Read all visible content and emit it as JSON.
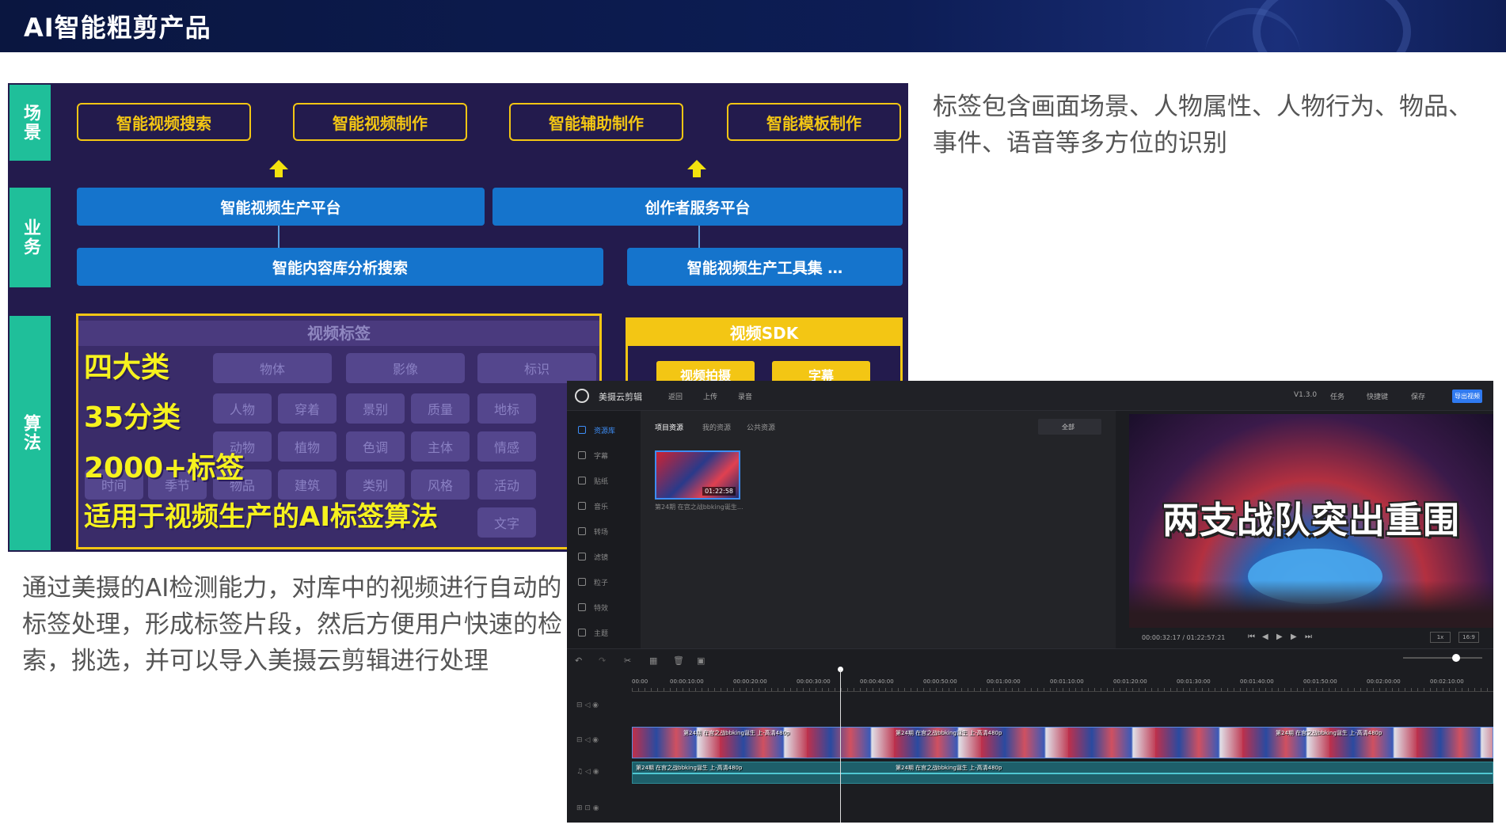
{
  "header": {
    "title": "AI智能粗剪产品"
  },
  "architecture": {
    "side_labels": {
      "scene": "场景",
      "business": "业务",
      "algorithm": "算法"
    },
    "scenes": [
      "智能视频搜索",
      "智能视频制作",
      "智能辅助制作",
      "智能模板制作"
    ],
    "platforms": [
      "智能视频生产平台",
      "创作者服务平台"
    ],
    "tools": [
      "智能内容库分析搜索",
      "智能视频生产工具集 …"
    ],
    "tag_panel": {
      "title": "视频标签",
      "cells": [
        "物体",
        "影像",
        "标识",
        "人物",
        "穿着",
        "景别",
        "质量",
        "地标",
        "动物",
        "植物",
        "色调",
        "主体",
        "情感",
        "时间",
        "季节",
        "物品",
        "建筑",
        "类别",
        "风格",
        "活动",
        "文字"
      ]
    },
    "highlights": {
      "line1": "四大类",
      "line2": "35分类",
      "line3": "2000+标签",
      "line4": "适用于视频生产的AI标签算法"
    },
    "sdk": {
      "title": "视频SDK",
      "buttons": [
        "视频拍摄",
        "字幕"
      ]
    }
  },
  "description_right": "标签包含画面场景、人物属性、人物行为、物品、事件、语音等多方位的识别",
  "description_left": "通过美摄的AI检测能力，对库中的视频进行自动的标签处理，形成标签片段，然后方便用户快速的检索，挑选，并可以导入美摄云剪辑进行处理",
  "editor": {
    "app_name": "美摄云剪辑",
    "toolbar": {
      "back": "返回",
      "upload": "上传",
      "record": "录音",
      "version": "V1.3.0",
      "tasks": "任务",
      "shortcuts": "快捷键",
      "save": "保存",
      "export": "导出视频"
    },
    "sidebar": [
      "资源库",
      "字幕",
      "贴纸",
      "音乐",
      "转场",
      "滤镜",
      "粒子",
      "特效",
      "主题"
    ],
    "media_tabs": [
      "项目资源",
      "我的资源",
      "公共资源"
    ],
    "filter_value": "全部",
    "clip": {
      "duration": "01:22:58",
      "name": "第24期 在宫之战bbking诞生..."
    },
    "preview": {
      "caption": "两支战队突出重围",
      "timecode": "00:00:32:17 / 01:22:57:21",
      "rate": "1x",
      "ratio": "16:9"
    },
    "ruler_ticks": [
      "00:00",
      "00:00:10:00",
      "00:00:20:00",
      "00:00:30:00",
      "00:00:40:00",
      "00:00:50:00",
      "00:01:00:00",
      "00:01:10:00",
      "00:01:20:00",
      "00:01:30:00",
      "00:01:40:00",
      "00:01:50:00",
      "00:02:00:00",
      "00:02:10:00"
    ],
    "clip_labels": [
      "第24期 在宫之战bbking诞生 上-高清480p",
      "第24期 在宫之战bbking诞生 上-高清480p",
      "第24期 在宫之战bbking诞生 上-高清480p"
    ],
    "audio_labels": [
      "第24期 在宫之战bbking诞生 上-高清480p",
      "第24期 在宫之战bbking诞生 上-高清480p"
    ]
  }
}
